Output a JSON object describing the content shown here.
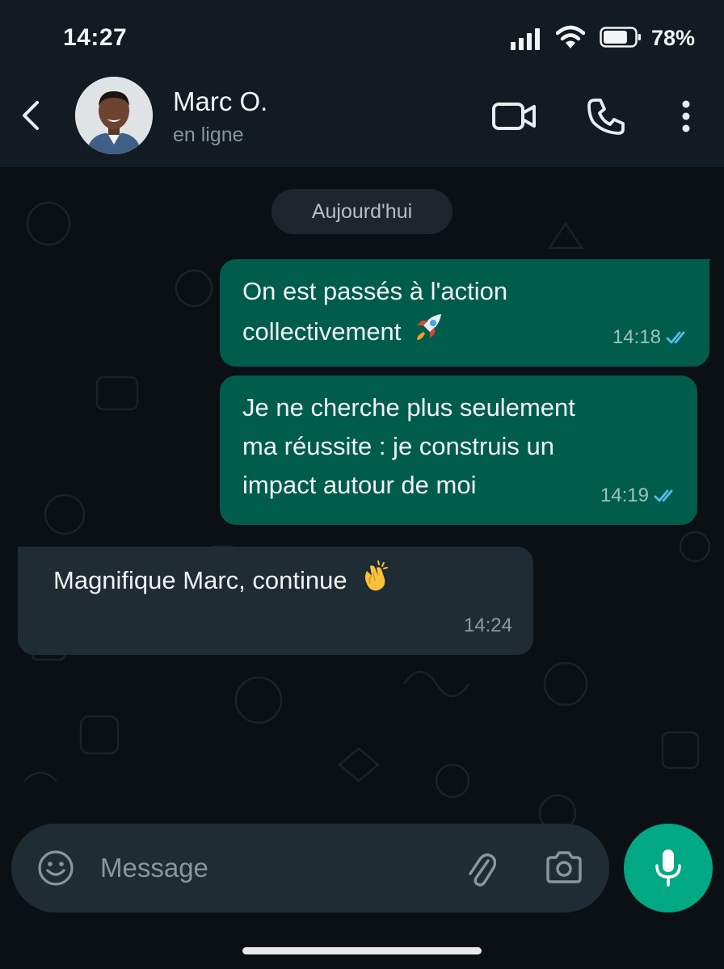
{
  "status_bar": {
    "time": "14:27",
    "battery_percent": "78%",
    "battery_level": 0.78
  },
  "header": {
    "contact_name": "Marc O.",
    "contact_status": "en ligne"
  },
  "chat": {
    "date_separator": "Aujourd'hui",
    "messages": [
      {
        "direction": "outgoing",
        "text": "On est passés à l'action\ncollectivement",
        "emoji": "rocket",
        "time": "14:18",
        "status": "read"
      },
      {
        "direction": "outgoing",
        "text": "Je ne cherche plus seulement\nma réussite : je construis un\nimpact autour de moi",
        "time": "14:19",
        "status": "read"
      },
      {
        "direction": "incoming",
        "text": "Magnifique Marc, continue",
        "emoji": "clapping-hands",
        "time": "14:24"
      }
    ]
  },
  "composer": {
    "placeholder": "Message"
  },
  "colors": {
    "outgoing_bubble": "#005c4b",
    "incoming_bubble": "#1f2c33",
    "accent": "#00a884",
    "read_tick": "#53bdeb",
    "background": "#0b1014",
    "header": "#111b21"
  },
  "icons": [
    "back-arrow-icon",
    "video-call-icon",
    "phone-call-icon",
    "more-options-icon",
    "emoji-icon",
    "attachment-icon",
    "camera-icon",
    "microphone-icon"
  ]
}
